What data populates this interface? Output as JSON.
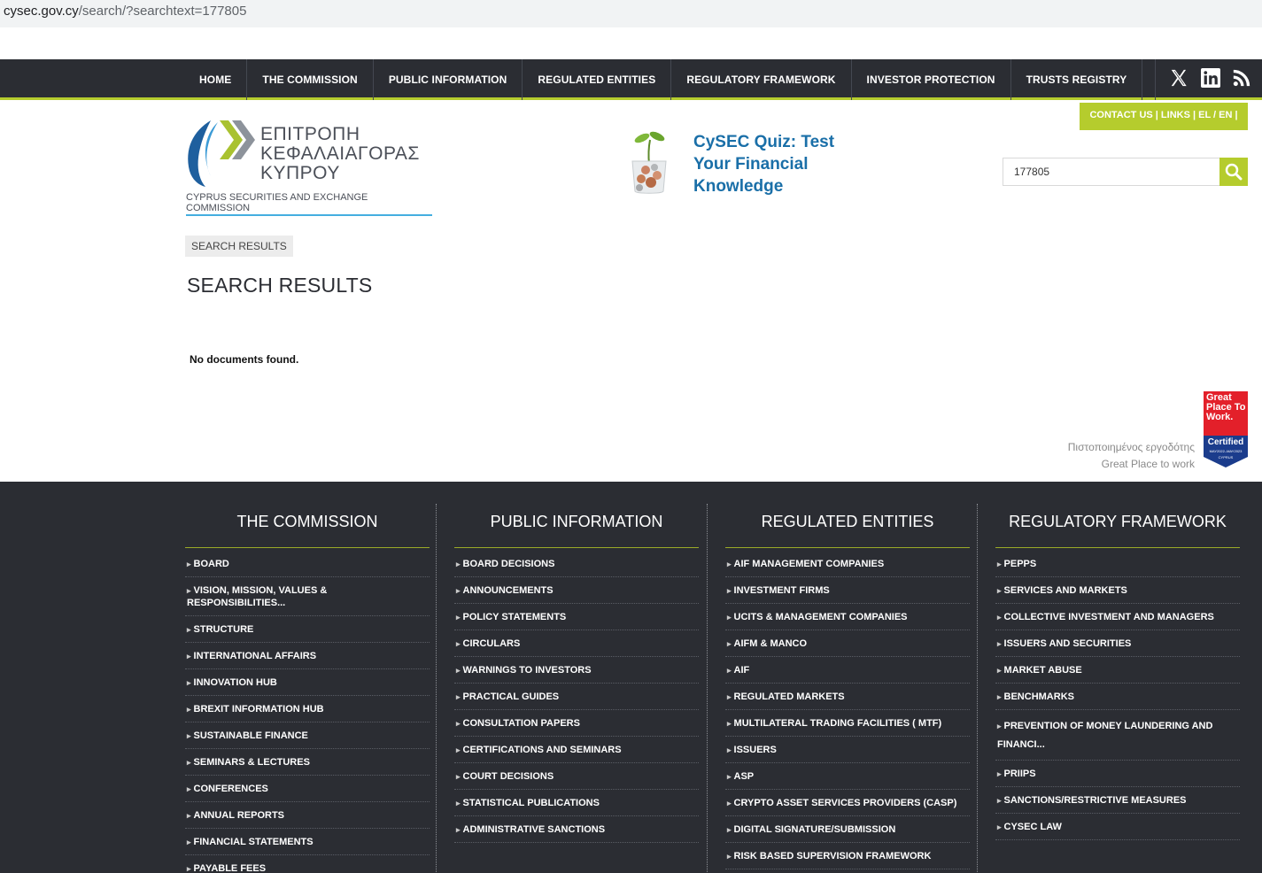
{
  "browser": {
    "url_host": "cysec.gov.cy",
    "url_path": "/search/?searchtext=177805"
  },
  "topnav": {
    "items": [
      "HOME",
      "THE COMMISSION",
      "PUBLIC INFORMATION",
      "REGULATED ENTITIES",
      "REGULATORY FRAMEWORK",
      "INVESTOR PROTECTION",
      "TRUSTS REGISTRY"
    ],
    "social": [
      "x-icon",
      "linkedin-icon",
      "rss-icon"
    ]
  },
  "contact_bar": "CONTACT US  |  LINKS  |   EL / EN  |",
  "logo": {
    "line1": "ΕΠΙΤΡΟΠΗ",
    "line2": "ΚΕΦΑΛΑΙΑΓΟΡΑΣ",
    "line3": "ΚΥΠΡΟΥ",
    "english": "CYPRUS SECURITIES AND EXCHANGE COMMISSION"
  },
  "quiz": {
    "line1": "CySEC Quiz: Test",
    "line2": "Your Financial",
    "line3": "Knowledge"
  },
  "search": {
    "value": "177805"
  },
  "breadcrumb": "SEARCH RESULTS",
  "page_title": "SEARCH RESULTS",
  "no_results": "No documents found.",
  "gptw": {
    "line1": "Πιστοποιημένος εργοδότης",
    "line2": "Great Place to work",
    "badge_title": "Great Place To Work.",
    "badge_certified": "Certified",
    "badge_dates": "MAY2022–MAY2023",
    "badge_country": "CYPRUS"
  },
  "footer": {
    "columns": [
      {
        "title": "THE COMMISSION",
        "items": [
          "BOARD",
          "VISION, MISSION, VALUES & RESPONSIBILITIES...",
          "STRUCTURE",
          "INTERNATIONAL AFFAIRS",
          "INNOVATION HUB",
          "BREXIT INFORMATION HUB",
          "SUSTAINABLE FINANCE",
          "SEMINARS & LECTURES",
          "CONFERENCES",
          "ANNUAL REPORTS",
          "FINANCIAL STATEMENTS",
          "PAYABLE FEES"
        ]
      },
      {
        "title": "PUBLIC INFORMATION",
        "items": [
          "BOARD DECISIONS",
          "ANNOUNCEMENTS",
          "POLICY STATEMENTS",
          "CIRCULARS",
          "WARNINGS TO INVESTORS",
          "PRACTICAL GUIDES",
          "CONSULTATION PAPERS",
          "CERTIFICATIONS AND SEMINARS",
          "COURT DECISIONS",
          "STATISTICAL PUBLICATIONS",
          "ADMINISTRATIVE SANCTIONS"
        ]
      },
      {
        "title": "REGULATED ENTITIES",
        "items": [
          "AIF MANAGEMENT COMPANIES",
          "INVESTMENT FIRMS",
          "UCITS & MANAGEMENT COMPANIES",
          "AIFM & MANCO",
          "AIF",
          "REGULATED MARKETS",
          "MULTILATERAL TRADING FACILITIES ( MTF)",
          "ISSUERS",
          "ASP",
          "CRYPTO ASSET SERVICES PROVIDERS (CASP)",
          "DIGITAL SIGNATURE/SUBMISSION",
          "RISK BASED SUPERVISION FRAMEWORK"
        ]
      },
      {
        "title": "REGULATORY FRAMEWORK",
        "items": [
          "PEPPS",
          "SERVICES AND MARKETS",
          "COLLECTIVE INVESTMENT AND MANAGERS",
          "ISSUERS AND SECURITIES",
          "MARKET ABUSE",
          "BENCHMARKS",
          "PREVENTION OF MONEY LAUNDERING AND FINANCI...",
          "PRIIPS",
          "SANCTIONS/RESTRICTIVE MEASURES",
          "CYSEC LAW"
        ]
      }
    ]
  }
}
